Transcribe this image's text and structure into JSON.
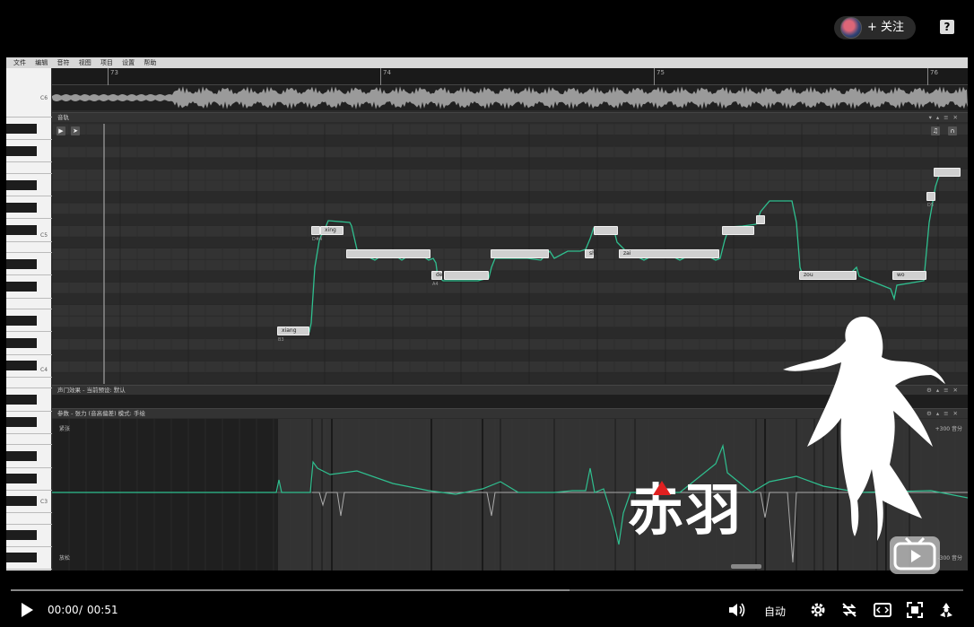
{
  "header": {
    "follow_label": "+ 关注",
    "help_label": "?"
  },
  "editor": {
    "menu": [
      "文件",
      "编辑",
      "音符",
      "视图",
      "项目",
      "设置",
      "帮助"
    ],
    "bars": [
      "73",
      "74",
      "75",
      "76"
    ],
    "octaves": [
      "C6",
      "C5",
      "C4",
      "C3"
    ],
    "track_label": "音轨",
    "effects_label": "声门效果 - 当前预设: 默认",
    "params_label": "参数 - 张力 (音高偏差) 模式: 手绘",
    "param_top_left": "紧张",
    "param_bottom_left": "放松",
    "param_top_right": "+300 音分",
    "param_bottom_right": "-300 音分",
    "notes": [
      {
        "lyric": "xiang",
        "sub": "B3"
      },
      {
        "lyric": "",
        "sub": "D#4"
      },
      {
        "lyric": "xing",
        "sub": ""
      },
      {
        "lyric": "",
        "sub": ""
      },
      {
        "lyric": "de",
        "sub": "A4"
      },
      {
        "lyric": "",
        "sub": ""
      },
      {
        "lyric": "",
        "sub": ""
      },
      {
        "lyric": "shi",
        "sub": ""
      },
      {
        "lyric": "",
        "sub": ""
      },
      {
        "lyric": "zai",
        "sub": ""
      },
      {
        "lyric": "",
        "sub": ""
      },
      {
        "lyric": "",
        "sub": ""
      },
      {
        "lyric": "zou",
        "sub": ""
      },
      {
        "lyric": "wo",
        "sub": ""
      },
      {
        "lyric": "",
        "sub": "D5"
      },
      {
        "lyric": "",
        "sub": ""
      }
    ]
  },
  "overlay": {
    "brand_text": "赤羽"
  },
  "player": {
    "current_time": "00:00",
    "separator": "/",
    "duration": "00:51",
    "quality_label": "自动",
    "progress": 0.0
  }
}
